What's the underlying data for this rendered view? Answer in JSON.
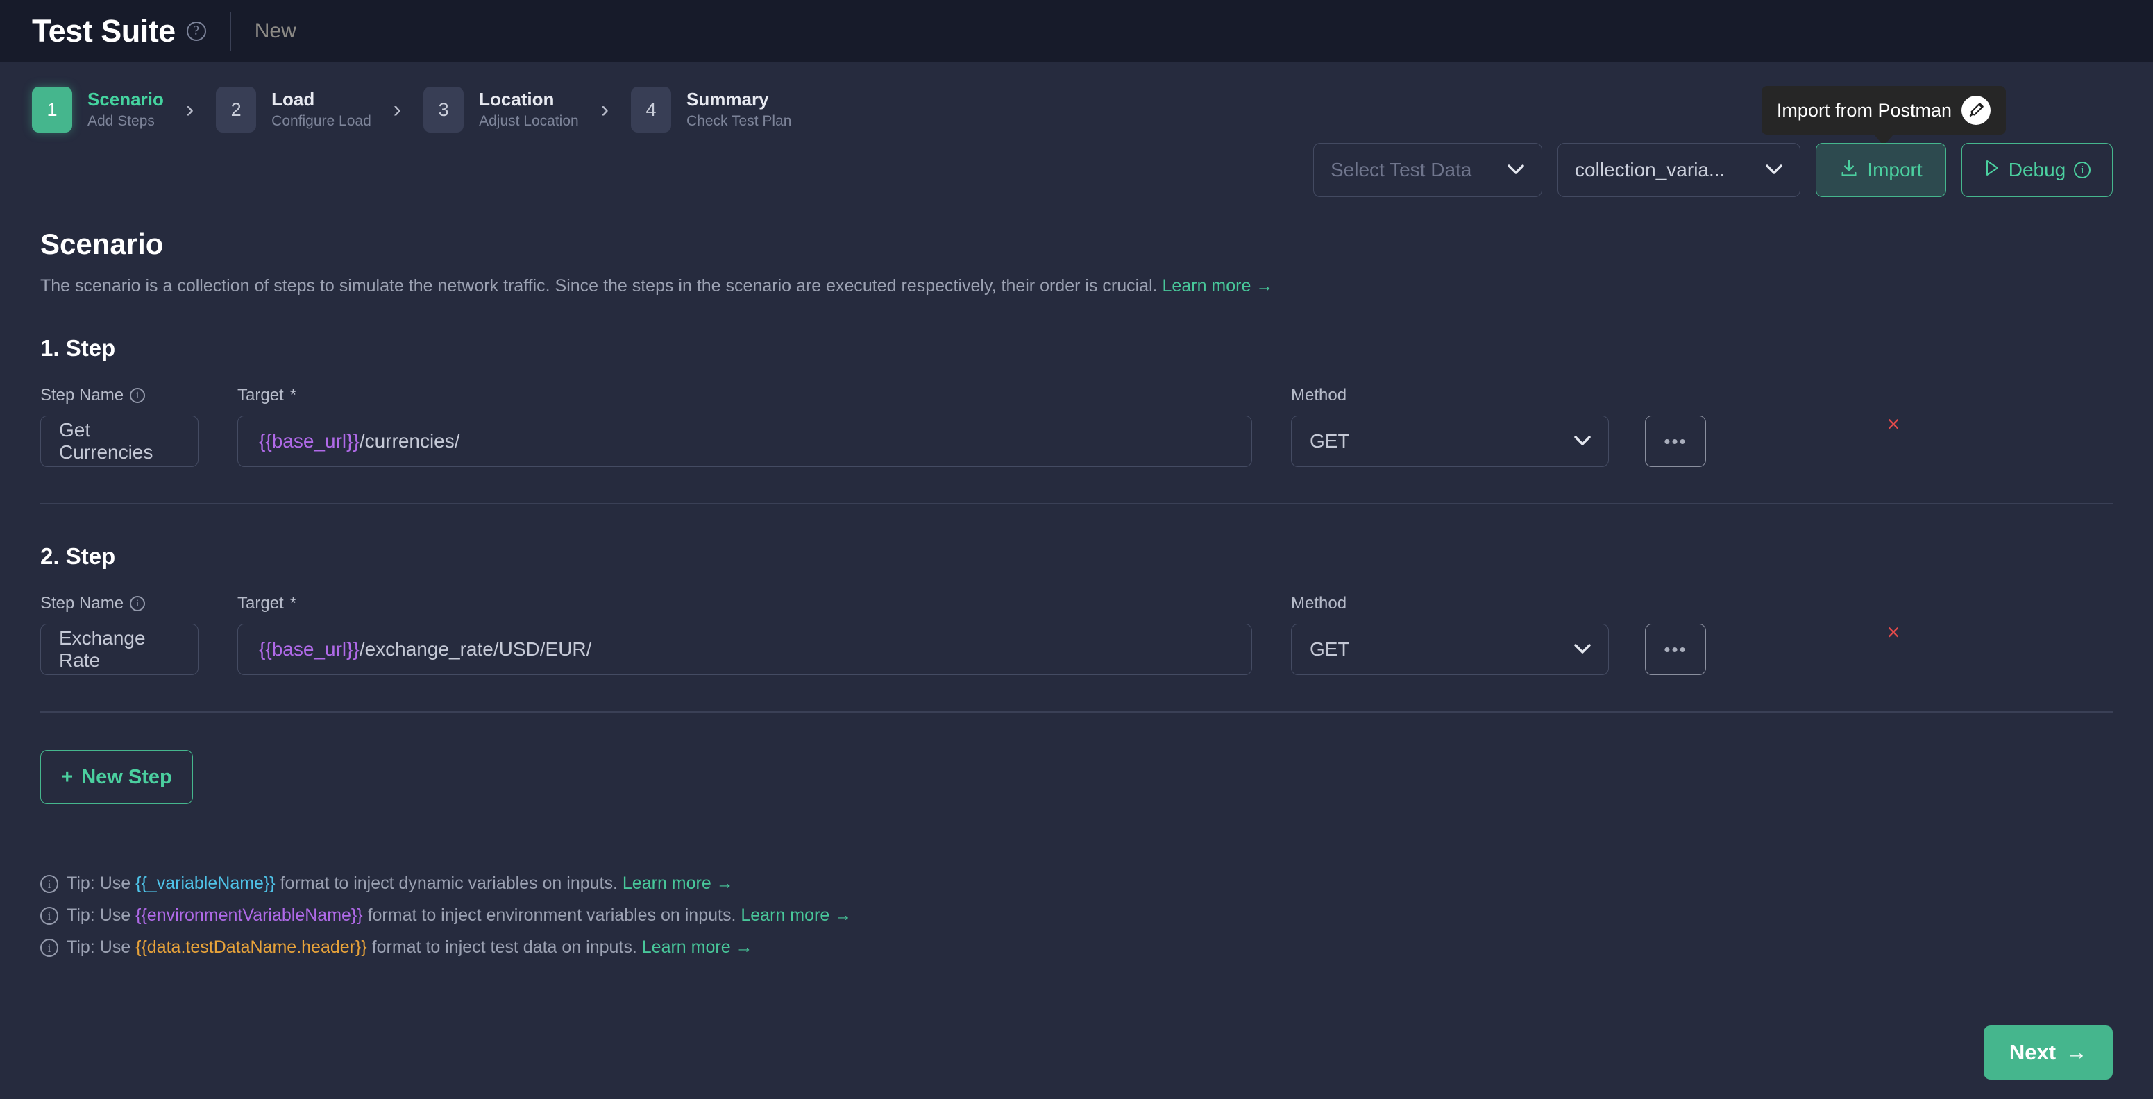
{
  "topbar": {
    "title": "Test Suite",
    "help_icon": "help-circle-icon",
    "subtitle": "New"
  },
  "stepper": {
    "steps": [
      {
        "number": "1",
        "title": "Scenario",
        "desc": "Add Steps",
        "active": true
      },
      {
        "number": "2",
        "title": "Load",
        "desc": "Configure Load",
        "active": false
      },
      {
        "number": "3",
        "title": "Location",
        "desc": "Adjust Location",
        "active": false
      },
      {
        "number": "4",
        "title": "Summary",
        "desc": "Check Test Plan",
        "active": false
      }
    ],
    "arrow": "›"
  },
  "toolbar": {
    "test_data_placeholder": "Select Test Data",
    "collection_value": "collection_varia...",
    "import_label": "Import",
    "debug_label": "Debug",
    "chevron": "⌄",
    "tooltip_text": "Import from Postman"
  },
  "main": {
    "title": "Scenario",
    "description": "The scenario is a collection of steps to simulate the network traffic. Since the steps in the scenario are executed respectively, their order is crucial.",
    "learn_more": "Learn more →",
    "new_step_label": "New Step",
    "new_step_plus": "+"
  },
  "labels": {
    "step_name": "Step Name",
    "target": "Target",
    "required_mark": "*",
    "method": "Method",
    "dots": "•••",
    "delete": "×"
  },
  "steps": [
    {
      "heading": "1. Step",
      "name": "Get Currencies",
      "target_var": "{{base_url}}",
      "target_rest": "/currencies/",
      "method": "GET"
    },
    {
      "heading": "2. Step",
      "name": "Exchange Rate",
      "target_var": "{{base_url}}",
      "target_rest": "/exchange_rate/USD/EUR/",
      "method": "GET"
    }
  ],
  "tips": [
    {
      "prefix": "Tip: Use ",
      "code": "{{_variableName}}",
      "code_color": "var-blue",
      "suffix": " format to inject dynamic variables on inputs.",
      "link": "Learn more →"
    },
    {
      "prefix": "Tip: Use ",
      "code": "{{environmentVariableName}}",
      "code_color": "var-purple",
      "suffix": " format to inject environment variables on inputs.",
      "link": "Learn more →"
    },
    {
      "prefix": "Tip: Use ",
      "code": "{{data.testDataName.header}}",
      "code_color": "var-orange",
      "suffix": " format to inject test data on inputs.",
      "link": "Learn more →"
    }
  ],
  "footer": {
    "next_label": "Next",
    "next_arrow": "→"
  },
  "colors": {
    "accent_green": "#45b68d",
    "accent_green_bright": "#4bcf9f",
    "page_bg": "#262b3e",
    "topbar_bg": "#171b2a",
    "danger_red": "#e04a4a",
    "var_purple": "#b06ae8",
    "var_blue": "#4fc3e8",
    "var_orange": "#e8a33a"
  }
}
